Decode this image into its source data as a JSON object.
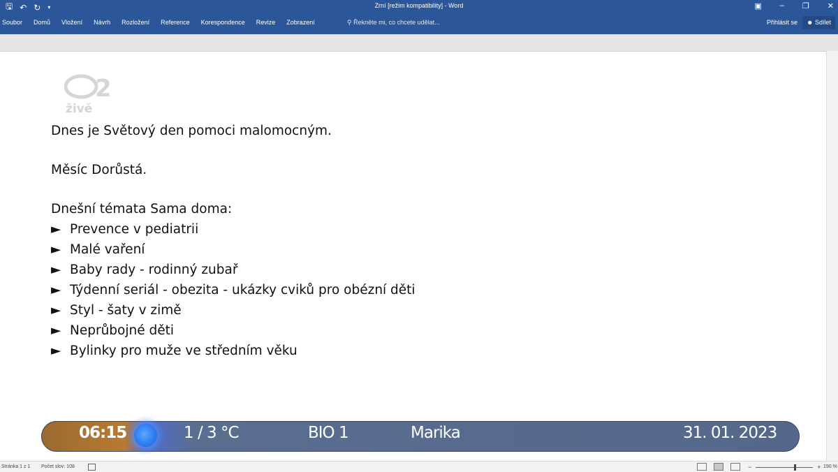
{
  "window": {
    "title": "Zrní [režim kompatibility] - Word",
    "qat": {
      "save_icon": "save-icon",
      "undo_icon": "undo-icon",
      "redo_icon": "redo-icon",
      "customize_icon": "customize-qat-icon"
    }
  },
  "ribbon": {
    "tabs": [
      "Soubor",
      "Domů",
      "Vložení",
      "Návrh",
      "Rozložení",
      "Reference",
      "Korespondence",
      "Revize",
      "Zobrazení"
    ],
    "tell_me": "Řekněte mi, co chcete udělat...",
    "sign_in": "Přihlásit se",
    "share": "Sdílet"
  },
  "watermark": {
    "text": "živě"
  },
  "document": {
    "line1": "Dnes je Světový den pomoci malomocným.",
    "line2": "Měsíc Dorůstá.",
    "line3": "Dnešní témata Sama doma:",
    "bullet_glyph": "►",
    "bullets": [
      "Prevence v pediatrii",
      "Malé vaření",
      "Baby rady - rodinný zubař",
      "Týdenní seriál - obezita - ukázky cviků pro obézní děti",
      "Styl - šaty v zimě",
      "Neprůbojné děti",
      "Bylinky pro muže ve středním věku"
    ]
  },
  "tv_overlay": {
    "time": "06:15",
    "temperature": "1 / 3 °C",
    "channel": "BIO 1",
    "name_day": "Marika",
    "date": "31. 01. 2023"
  },
  "status_bar": {
    "page": "Stránka 1 z 1",
    "words": "Počet slov: 108",
    "zoom_out": "−",
    "zoom_in": "+",
    "zoom": "190 %"
  }
}
